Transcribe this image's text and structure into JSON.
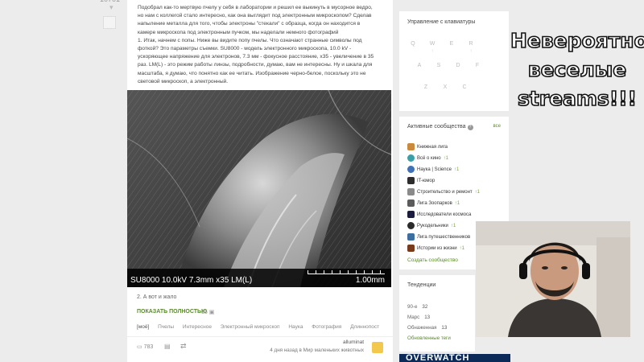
{
  "gutter": {
    "rating": "10701",
    "vote_icon": "chevron-down-icon"
  },
  "story": {
    "paragraphs": [
      "Подобрал как-то мертвую пчелу у себя в лаборатории и решил ее выкинуть в мусорное ведро, но нам с коллегой стало интересно, как она выглядит под электронным микроскопом? Сделав напыление металла для того, чтобы электроны \"стекали\" с образца, когда он находится в камере микроскопа под электронным пучком, мы наделали немного фотографий",
      "1. Итак, начнем с попы. Ниже вы видите попу пчелы. Что означают странные символы под фоткой? Это параметры съемки. SU8000 - модель электронного микроскопа, 10.0 kV - ускоряющее напряжение для электронов, 7.3 мм - фокусное расстояние, x35 - увеличение в 35 раз. LM(L) - это режим работы линзы, подробности, думаю, вам не интересны. Ну и шкала для масштаба, я думаю, что понятно как ее читать. Изображение черно-белое, поскольку это не световой микроскоп, а электронный."
    ],
    "figure": {
      "caption": "SU8000 10.0kV 7.3mm x35 LM(L)",
      "scale": "1.00mm"
    },
    "after_text": "2. А вот и жало",
    "show_full_label": "ПОКАЗАТЬ ПОЛНОСТЬЮ",
    "show_full_count": "15",
    "tags": [
      "[моё]",
      "Пчелы",
      "Интересное",
      "Электронный микроскоп",
      "Наука",
      "Фотография",
      "Длиннопост"
    ],
    "comments_count": "783",
    "author": "alluminat",
    "author_meta": "4 дня назад в Мир маленьких животных"
  },
  "keyboard_panel": {
    "title": "Управление с клавиатуры",
    "keys": [
      {
        "k": "Q",
        "s": ""
      },
      {
        "k": "W",
        "s": "↑"
      },
      {
        "k": "E",
        "s": ""
      },
      {
        "k": "R",
        "s": "↑"
      },
      {
        "k": "A",
        "s": ""
      },
      {
        "k": "S",
        "s": ""
      },
      {
        "k": "D",
        "s": ""
      },
      {
        "k": "F",
        "s": ""
      },
      {
        "k": "Z",
        "s": ""
      },
      {
        "k": "X",
        "s": ""
      },
      {
        "k": "C",
        "s": ""
      }
    ]
  },
  "communities": {
    "title": "Активные сообщества",
    "all_label": "все",
    "items": [
      {
        "name": "Книжная лига",
        "badge": "",
        "color": "#c98a3c"
      },
      {
        "name": "Всё о кино",
        "badge": "1",
        "color": "#3aa0a8"
      },
      {
        "name": "Наука | Science",
        "badge": "1",
        "color": "#3f72b5"
      },
      {
        "name": "IT-юмор",
        "badge": "",
        "color": "#2d2d2d"
      },
      {
        "name": "Строительство и ремонт",
        "badge": "1",
        "color": "#8a8a8a"
      },
      {
        "name": "Лига Зоопарков",
        "badge": "1",
        "color": "#5b5b5b"
      },
      {
        "name": "Исследователи космоса",
        "badge": "",
        "color": "#1c1c3c"
      },
      {
        "name": "Рукодельники",
        "badge": "1",
        "color": "#2a2a2a"
      },
      {
        "name": "Лига путешественников",
        "badge": "",
        "color": "#3c6ea0"
      },
      {
        "name": "Истории из жизни",
        "badge": "1",
        "color": "#7a3b1b"
      }
    ],
    "create_label": "Создать сообщество"
  },
  "trends": {
    "title": "Тенденции",
    "items": [
      {
        "name": "90-е",
        "value": "32"
      },
      {
        "name": "Марс",
        "value": "13"
      },
      {
        "name": "Обнаженная",
        "value": "13"
      }
    ],
    "more_label": "Обновленные теги"
  },
  "ad": {
    "label": "OVERWATCH"
  },
  "overlay": {
    "lines": [
      "Невероятно",
      "веселые",
      "streams!!!"
    ]
  },
  "colors": {
    "accent_green": "#5a8a2c",
    "page_bg": "#ececec",
    "panel_bg": "#ffffff"
  }
}
